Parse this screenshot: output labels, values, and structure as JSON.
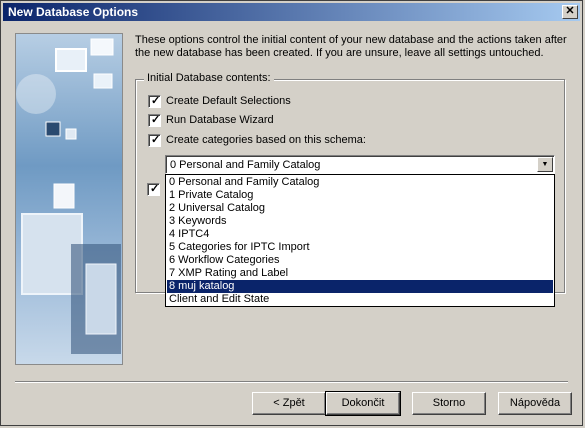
{
  "window": {
    "title": "New Database Options",
    "close_glyph": "✕"
  },
  "intro_text": "These options control the initial content of your new database and the actions taken after the new database has been created. If you are unsure, leave all settings untouched.",
  "group": {
    "label": "Initial Database contents:",
    "checkboxes": [
      {
        "label": "Create Default Selections",
        "checked": true
      },
      {
        "label": "Run Database Wizard",
        "checked": true
      },
      {
        "label": "Create categories based on this schema:",
        "checked": true
      }
    ],
    "hidden_checkbox_checked": true
  },
  "combo": {
    "selected": "0 Personal and Family Catalog",
    "arrow_glyph": "▼",
    "options": [
      "0 Personal and Family Catalog",
      "1 Private Catalog",
      "2 Universal Catalog",
      "3 Keywords",
      "4 IPTC4",
      "5 Categories for IPTC Import",
      "6 Workflow Categories",
      "7 XMP Rating and Label",
      "8 muj katalog",
      "Client and Edit State"
    ],
    "highlighted_index": 8
  },
  "buttons": {
    "back": "< Zpět",
    "finish": "Dokončit",
    "cancel": "Storno",
    "help": "Nápověda"
  },
  "check_glyph": "✓"
}
